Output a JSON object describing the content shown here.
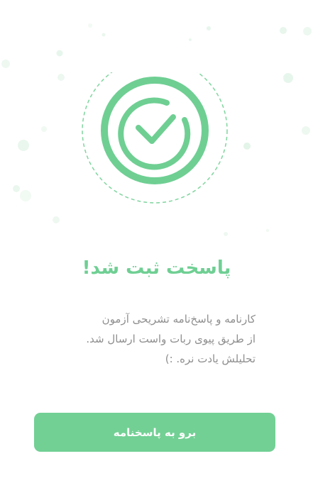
{
  "success": {
    "title": "پاسخت ثبت شد!",
    "description_lines": [
      "کارنامه و پاسخ‌نامه تشریحی آزمون",
      "از طریق پیوی ربات واست ارسال شد.",
      "تحلیلش یادت نره. :)"
    ]
  },
  "actions": {
    "go_to_answers_label": "برو به پاسخنامه"
  },
  "colors": {
    "accent": "#6fcf93",
    "button": "#72d094",
    "text_muted": "#8f8f8f"
  },
  "icons": {
    "main": "check-circle-icon"
  }
}
